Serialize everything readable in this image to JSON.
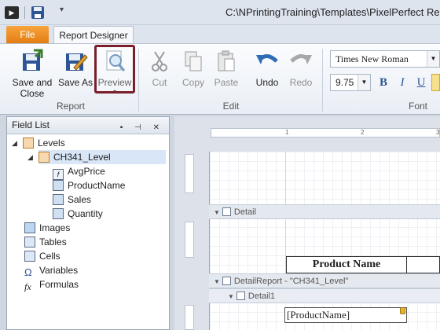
{
  "window": {
    "title": "C:\\NPrintingTraining\\Templates\\PixelPerfect Report"
  },
  "quick_access": {
    "more_label": "▾"
  },
  "tabs": [
    {
      "label": "File"
    },
    {
      "label": "Report Designer"
    }
  ],
  "ribbon": {
    "save_close": "Save and Close",
    "save_as": "Save As",
    "preview": "Preview",
    "preview_arrow": "▾",
    "cut": "Cut",
    "copy": "Copy",
    "paste": "Paste",
    "undo": "Undo",
    "redo": "Redo",
    "group_report": "Report",
    "group_edit": "Edit",
    "group_font": "Font",
    "font_name": "Times New Roman",
    "font_size": "9.75",
    "bold": "B",
    "italic": "I",
    "underline": "U"
  },
  "field_list": {
    "title": "Field List",
    "items": [
      {
        "label": "Levels"
      },
      {
        "label": "CH341_Level"
      },
      {
        "label": "AvgPrice"
      },
      {
        "label": "ProductName"
      },
      {
        "label": "Sales"
      },
      {
        "label": "Quantity"
      },
      {
        "label": "Images"
      },
      {
        "label": "Tables"
      },
      {
        "label": "Cells"
      },
      {
        "label": "Variables"
      },
      {
        "label": "Formulas"
      }
    ]
  },
  "designer": {
    "ruler_marks": [
      "1",
      "2",
      "3"
    ],
    "bands": [
      {
        "label": "Detail"
      },
      {
        "label": "DetailReport - \"CH341_Level\""
      },
      {
        "label": "Detail1"
      }
    ],
    "header_cell": "Product Name",
    "field_cell": "[ProductName]"
  },
  "colors": {
    "file_tab": "#e47c0f",
    "highlight": "#7a1f2b",
    "accent": "#2f5597"
  }
}
